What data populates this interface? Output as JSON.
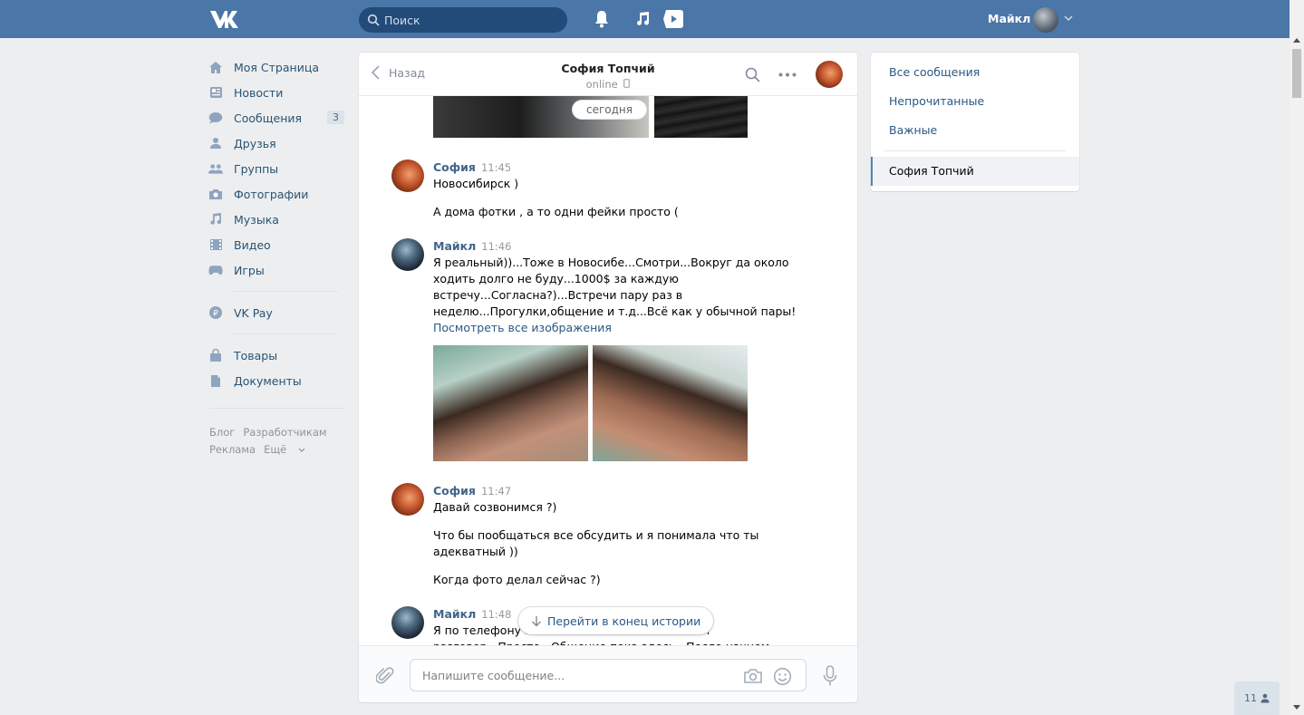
{
  "topbar": {
    "search_placeholder": "Поиск",
    "user_name": "Майкл"
  },
  "nav": {
    "items": [
      {
        "label": "Моя Страница",
        "icon": "home-icon"
      },
      {
        "label": "Новости",
        "icon": "news-icon"
      },
      {
        "label": "Сообщения",
        "icon": "messages-icon",
        "count": "3"
      },
      {
        "label": "Друзья",
        "icon": "friends-icon"
      },
      {
        "label": "Группы",
        "icon": "groups-icon"
      },
      {
        "label": "Фотографии",
        "icon": "camera-icon"
      },
      {
        "label": "Музыка",
        "icon": "music-icon"
      },
      {
        "label": "Видео",
        "icon": "video-icon"
      },
      {
        "label": "Игры",
        "icon": "gamepad-icon"
      },
      {
        "label": "VK Pay",
        "icon": "vkpay-icon"
      },
      {
        "label": "Товары",
        "icon": "bag-icon"
      },
      {
        "label": "Документы",
        "icon": "document-icon"
      }
    ],
    "footer": [
      "Блог",
      "Разработчикам",
      "Реклама",
      "Ещё"
    ]
  },
  "chat": {
    "back_label": "Назад",
    "peer_name": "София Топчий",
    "peer_status": "online",
    "date_pill": "сегодня",
    "messages": [
      {
        "author": "София",
        "time": "11:45",
        "lines": [
          "Новосибирск )",
          "А дома фотки , а то одни фейки просто ("
        ]
      },
      {
        "author": "Майкл",
        "time": "11:46",
        "text": "Я реальный))...Тоже в Новосибе...Смотри...Вокруг да около\nходить долго не буду...1000$ за каждую\nвстречу...Согласна?)...Встречи пару раз в\nнеделю...Прогулки,общение и т.д...Всё как у обычной пары!",
        "link": "Посмотреть все изображения"
      },
      {
        "author": "София",
        "time": "11:47",
        "lines": [
          "Давай созвонимся ?)",
          "Что бы пообщаться все обсудить и я понимала что ты\nадекватный ))",
          "Когда фото делал сейчас ?)"
        ]
      },
      {
        "author": "Майкл",
        "time": "11:48",
        "text": "Я по телефону не ...                         ...записали\nразговор...Просто...Общение пока здесь...После начнем"
      }
    ],
    "goto_end_label": "Перейти в конец истории",
    "input_placeholder": "Напишите сообщение..."
  },
  "right_menu": {
    "items": [
      "Все сообщения",
      "Непрочитанные",
      "Важные"
    ],
    "active": "София Топчий"
  },
  "friends_widget": {
    "count": "11"
  },
  "colors": {
    "brand": "#4a76a8",
    "link": "#2a5885",
    "author": "#42648b"
  }
}
